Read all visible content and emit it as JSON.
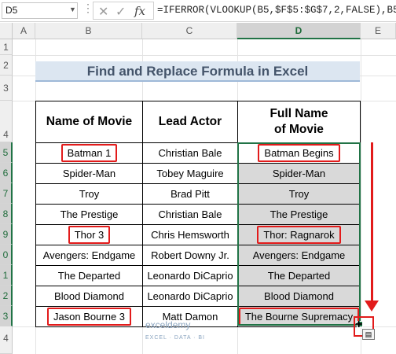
{
  "formula_bar": {
    "name_box": "D5",
    "fx": "fx",
    "formula": "=IFERROR(VLOOKUP(B5,$F$5:$G$7,2,FALSE),B5)"
  },
  "columns": [
    "A",
    "B",
    "C",
    "D",
    "E"
  ],
  "rows": [
    "1",
    "2",
    "3",
    "4",
    "5",
    "6",
    "7",
    "8",
    "9",
    "0",
    "1",
    "2",
    "3",
    "4"
  ],
  "title": "Find and Replace Formula in Excel",
  "table": {
    "headers": [
      "Name of Movie",
      "Lead Actor",
      "Full Name\nof Movie"
    ],
    "rows": [
      {
        "movie": "Batman 1",
        "actor": "Christian Bale",
        "full": "Batman Begins",
        "hl_movie": true,
        "hl_full": true
      },
      {
        "movie": "Spider-Man",
        "actor": "Tobey Maguire",
        "full": "Spider-Man"
      },
      {
        "movie": "Troy",
        "actor": "Brad Pitt",
        "full": "Troy"
      },
      {
        "movie": "The Prestige",
        "actor": "Christian Bale",
        "full": "The Prestige"
      },
      {
        "movie": "Thor 3",
        "actor": "Chris Hemsworth",
        "full": "Thor: Ragnarok",
        "hl_movie": true,
        "hl_full": true
      },
      {
        "movie": "Avengers: Endgame",
        "actor": "Robert Downy Jr.",
        "full": "Avengers: Endgame"
      },
      {
        "movie": "The Departed",
        "actor": "Leonardo DiCaprio",
        "full": "The Departed"
      },
      {
        "movie": "Blood Diamond",
        "actor": "Leonardo DiCaprio",
        "full": "Blood Diamond"
      },
      {
        "movie": "Jason Bourne 3",
        "actor": "Matt Damon",
        "full": "The Bourne Supremacy",
        "hl_movie": true,
        "hl_full": true
      }
    ]
  },
  "watermark": {
    "brand": "exceldemy",
    "tagline": "EXCEL · DATA · BI"
  },
  "colors": {
    "accent": "#217346",
    "highlight": "#e21b1b",
    "title_bg": "#dce6f1"
  }
}
